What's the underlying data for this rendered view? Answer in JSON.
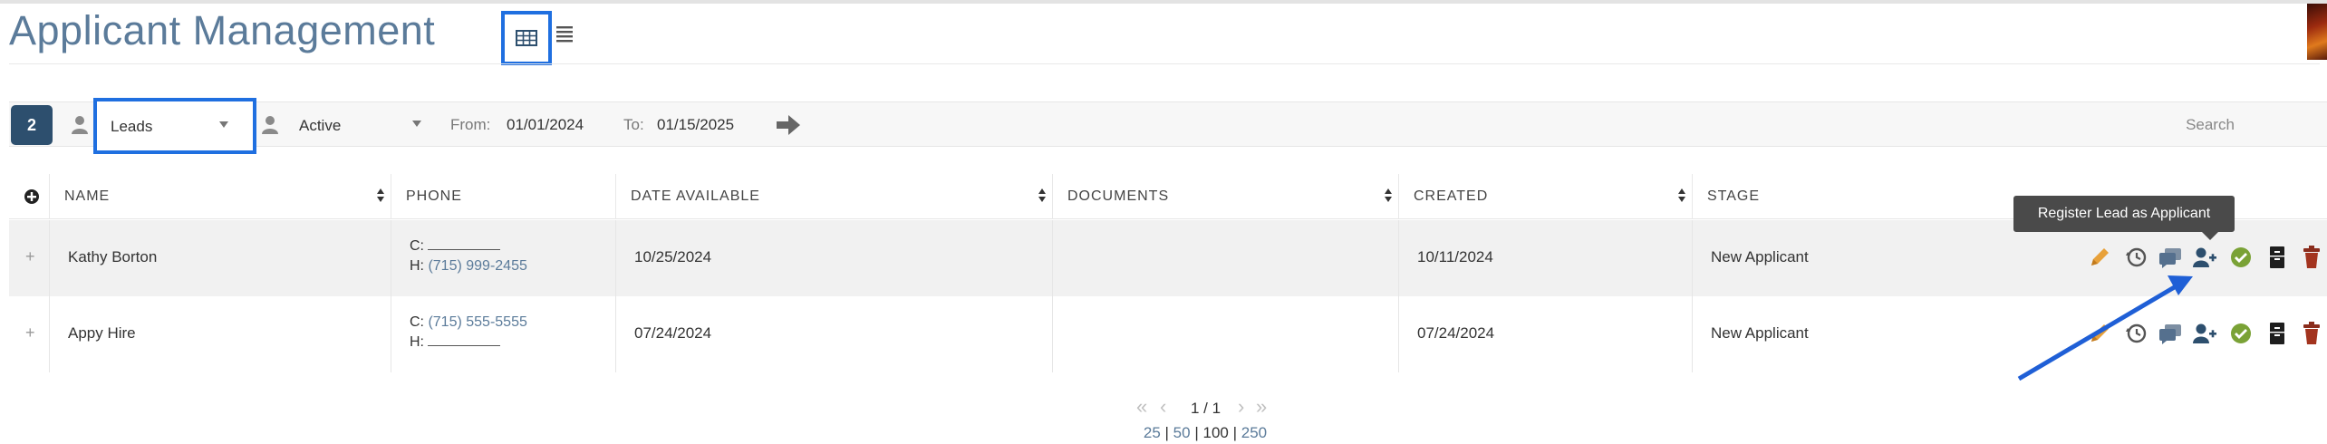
{
  "header": {
    "title": "Applicant Management"
  },
  "filters": {
    "count": "2",
    "type": "Leads",
    "status": "Active",
    "from_label": "From:",
    "from_value": "01/01/2024",
    "to_label": "To:",
    "to_value": "01/15/2025",
    "search_placeholder": "Search"
  },
  "table": {
    "columns": [
      "NAME",
      "PHONE",
      "DATE AVAILABLE",
      "DOCUMENTS",
      "CREATED",
      "STAGE"
    ],
    "rows": [
      {
        "name": "Kathy Borton",
        "phone_c_label": "C:",
        "phone_c": "",
        "phone_h_label": "H:",
        "phone_h": "(715) 999-2455",
        "date_available": "10/25/2024",
        "documents": "",
        "created": "10/11/2024",
        "stage": "New Applicant"
      },
      {
        "name": "Appy Hire",
        "phone_c_label": "C:",
        "phone_c": "(715) 555-5555",
        "phone_h_label": "H:",
        "phone_h": "",
        "date_available": "07/24/2024",
        "documents": "",
        "created": "07/24/2024",
        "stage": "New Applicant"
      }
    ]
  },
  "tooltip": {
    "text": "Register Lead as Applicant"
  },
  "pagination": {
    "current": "1 / 1",
    "size_25": "25",
    "size_50": "50",
    "size_100": "100",
    "size_250": "250",
    "sep": "|"
  },
  "colors": {
    "accent": "#5b7b9a",
    "badge": "#2d4f6e",
    "highlight": "#1f6fe0",
    "edit": "#e8a13a",
    "approve": "#7aa236",
    "delete": "#8a2c1c"
  },
  "icons": [
    "grid-view-icon",
    "list-view-icon",
    "user-icon",
    "arrow-right-icon",
    "plus-circle-icon",
    "pencil-icon",
    "history-icon",
    "chat-icon",
    "user-plus-icon",
    "check-circle-icon",
    "cabinet-icon",
    "trash-icon"
  ]
}
